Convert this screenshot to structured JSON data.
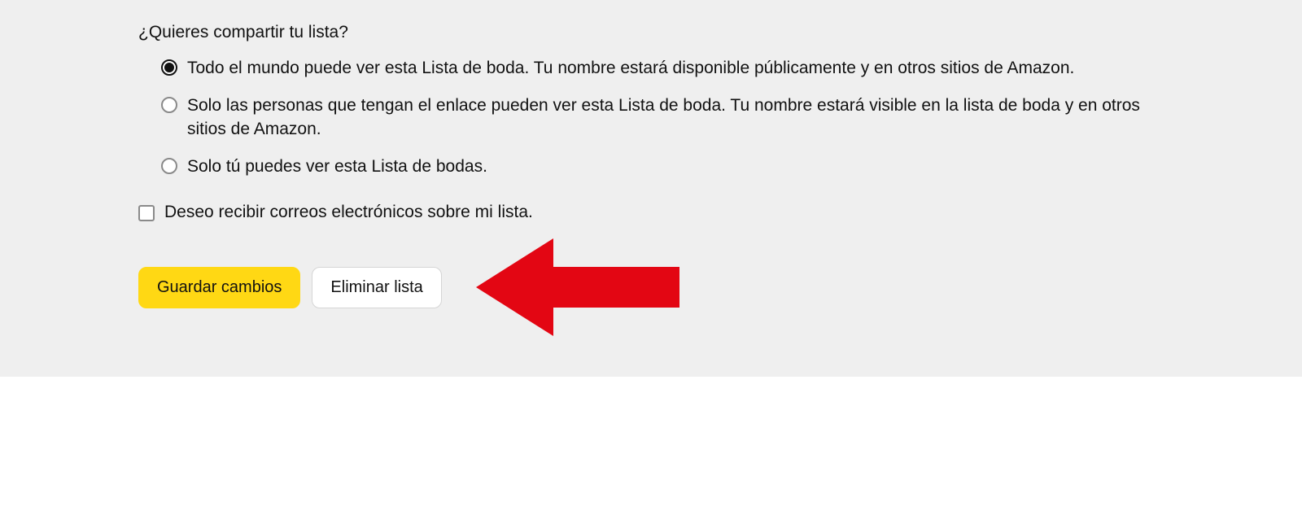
{
  "share": {
    "question": "¿Quieres compartir tu lista?",
    "options": [
      {
        "label": "Todo el mundo puede ver esta Lista de boda. Tu nombre estará disponible públicamente y en otros sitios de Amazon.",
        "selected": true
      },
      {
        "label": "Solo las personas que tengan el enlace pueden ver esta Lista de boda. Tu nombre estará visible en la lista de boda y en otros sitios de Amazon.",
        "selected": false
      },
      {
        "label": "Solo tú puedes ver esta Lista de bodas.",
        "selected": false
      }
    ]
  },
  "emails": {
    "label": "Deseo recibir correos electrónicos sobre mi lista.",
    "checked": false
  },
  "buttons": {
    "save": "Guardar cambios",
    "delete": "Eliminar lista"
  },
  "annotation": {
    "arrow_color": "#e30613"
  }
}
